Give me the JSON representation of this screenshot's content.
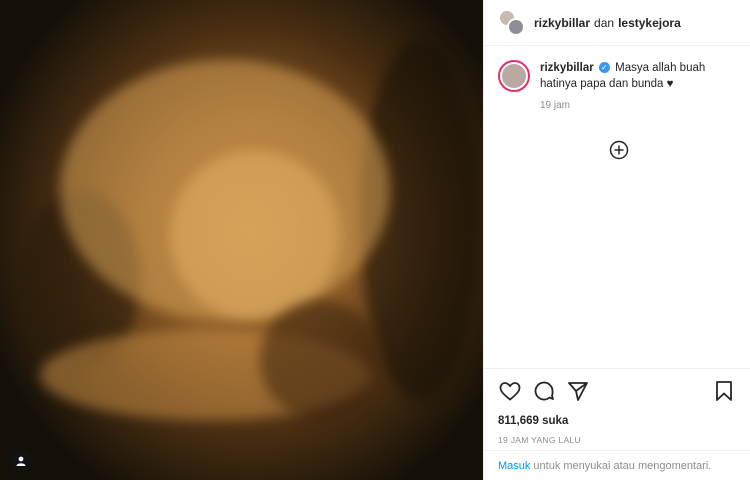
{
  "header": {
    "user1": "rizkybillar",
    "connector": "dan",
    "user2": "lestykejora"
  },
  "caption": {
    "username": "rizkybillar",
    "text": "Masya allah buah hatinya papa dan bunda",
    "time": "19 jam"
  },
  "actions": {
    "likes": "811,669 suka",
    "posted": "19 JAM YANG LALU"
  },
  "login": {
    "link": "Masuk",
    "text": "untuk menyukai atau mengomentari."
  },
  "colors": {
    "link": "#0095f6",
    "verified": "#3897f0",
    "ring": "#e1306c"
  },
  "icons": [
    "user-tag-icon",
    "verified-icon",
    "heart-icon",
    "load-more-icon",
    "like-icon",
    "comment-icon",
    "share-icon",
    "save-icon"
  ]
}
